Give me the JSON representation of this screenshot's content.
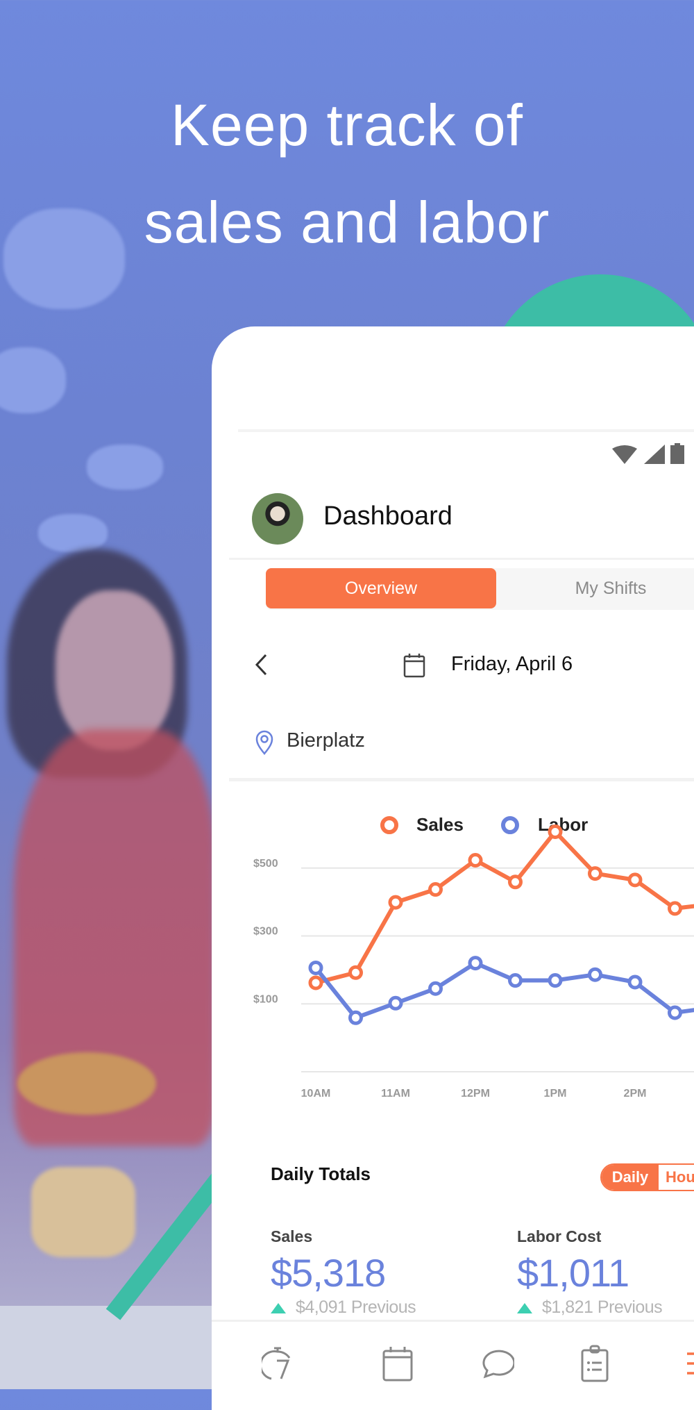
{
  "headline": {
    "line1": "Keep track of",
    "line2": "sales and labor"
  },
  "colors": {
    "background": "#6f89dd",
    "accent_orange": "#f87447",
    "accent_blue": "#6a82dc",
    "teal": "#3dbda6"
  },
  "app": {
    "status_icons": [
      "wifi-icon",
      "signal-icon",
      "battery-icon"
    ],
    "header": {
      "title": "Dashboard",
      "avatar": "user-avatar"
    },
    "tabs": [
      {
        "label": "Overview",
        "active": true
      },
      {
        "label": "My Shifts",
        "active": false
      }
    ],
    "date_row": {
      "date": "Friday, April 6",
      "prev_icon": "chevron-left-icon",
      "calendar_icon": "calendar-icon"
    },
    "location": {
      "name": "Bierplatz",
      "icon": "location-pin-icon"
    },
    "daily_totals": {
      "title": "Daily Totals",
      "toggle": [
        {
          "label": "Daily",
          "active": true
        },
        {
          "label": "Hou",
          "active": false
        }
      ],
      "sales": {
        "label": "Sales",
        "value": "$5,318",
        "previous": "$4,091 Previous",
        "trend": "up"
      },
      "labor": {
        "label": "Labor Cost",
        "value": "$1,011",
        "previous": "$1,821 Previous",
        "trend": "up"
      }
    },
    "bottom_nav": [
      "timeclock-icon",
      "calendar-icon",
      "chat-icon",
      "clipboard-icon",
      "menu-icon"
    ]
  },
  "chart_data": {
    "type": "line",
    "legend": [
      "Sales",
      "Labor"
    ],
    "legend_placement": "top",
    "x": [
      "10:00AM",
      "10:30AM",
      "11:00AM",
      "11:30AM",
      "12:00PM",
      "12:30PM",
      "1:00PM",
      "1:30PM",
      "2:00PM",
      "2:30PM",
      "3:00PM"
    ],
    "x_tick_labels": [
      "10AM",
      "11AM",
      "12PM",
      "1PM",
      "2PM"
    ],
    "y_tick_labels": [
      "$500",
      "$300",
      "$100"
    ],
    "ylim": [
      -100,
      700
    ],
    "grid": true,
    "series": [
      {
        "name": "Sales",
        "color": "#f87447",
        "values": [
          162,
          192,
          399,
          437,
          523,
          459,
          607,
          484,
          465,
          381,
          395
        ]
      },
      {
        "name": "Labor",
        "color": "#6a82dc",
        "values": [
          206,
          59,
          102,
          145,
          220,
          169,
          169,
          186,
          164,
          74,
          90
        ]
      }
    ]
  }
}
